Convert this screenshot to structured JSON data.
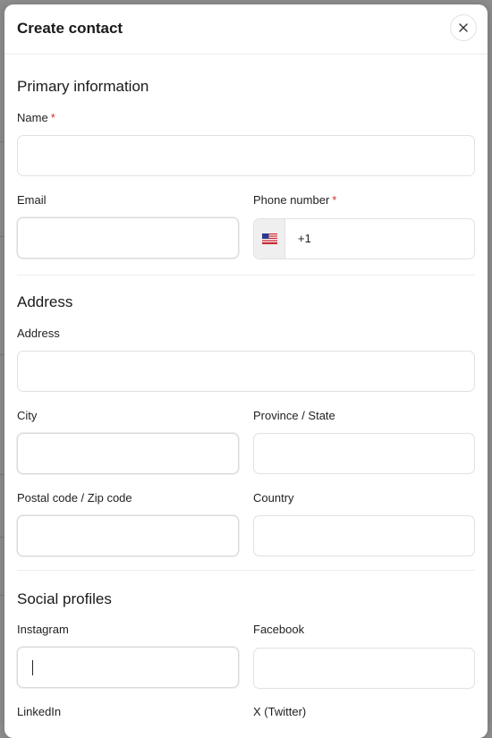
{
  "modal": {
    "title": "Create contact",
    "close_icon": "close-icon"
  },
  "primary": {
    "title": "Primary information",
    "name_label": "Name",
    "name_value": "",
    "email_label": "Email",
    "email_value": "",
    "phone_label": "Phone number",
    "phone_flag": "us-flag-icon",
    "phone_dial_code": "+1",
    "phone_value": "",
    "required_mark": "*"
  },
  "address": {
    "title": "Address",
    "address_label": "Address",
    "address_value": "",
    "city_label": "City",
    "city_value": "",
    "province_label": "Province / State",
    "province_value": "",
    "postal_label": "Postal code / Zip code",
    "postal_value": "",
    "country_label": "Country",
    "country_value": ""
  },
  "social": {
    "title": "Social profiles",
    "instagram_label": "Instagram",
    "instagram_value": "",
    "facebook_label": "Facebook",
    "facebook_value": "",
    "linkedin_label": "LinkedIn",
    "twitter_label": "X (Twitter)"
  },
  "colors": {
    "required": "#d32f2f",
    "backdrop": "#8c8c8c",
    "surface": "#ffffff"
  }
}
